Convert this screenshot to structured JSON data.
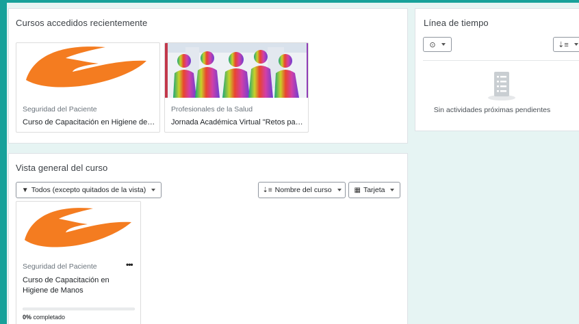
{
  "recent": {
    "title": "Cursos accedidos recientemente",
    "courses": [
      {
        "category": "Seguridad del Paciente",
        "name": "Curso de Capacitación en Higiene de M..."
      },
      {
        "category": "Profesionales de la Salud",
        "name": "Jornada Académica Virtual \"Retos para ..."
      }
    ]
  },
  "timeline": {
    "title": "Línea de tiempo",
    "empty_text": "Sin actividades próximas pendientes"
  },
  "overview": {
    "title": "Vista general del curso",
    "filter_label": "Todos (excepto quitados de la vista)",
    "sort_label": "Nombre del curso",
    "view_label": "Tarjeta",
    "course": {
      "category": "Seguridad del Paciente",
      "name_line1": "Curso de Capacitación en",
      "name_line2": "Higiene de Manos",
      "progress_value": "0%",
      "progress_suffix": " completado",
      "progress_fraction": 0
    }
  },
  "colors": {
    "accent": "#17a19a",
    "logo": "#f47c20"
  }
}
